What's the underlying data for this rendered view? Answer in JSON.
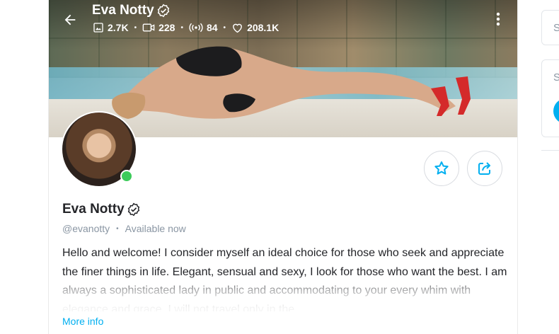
{
  "header": {
    "name": "Eva Notty",
    "stats": {
      "photos": "2.7K",
      "videos": "228",
      "streams": "84",
      "likes": "208.1K"
    }
  },
  "profile": {
    "name": "Eva Notty",
    "handle": "@evanotty",
    "status": "Available now",
    "bio": "Hello and welcome! I consider myself an ideal choice for those who seek and appreciate the finer things in life. Elegant, sensual and sexy, I look for those who want the best. I am always a sophisticated lady in public and accommodating to your every whim with elegance and grace. I will not travel only in the…",
    "more_info_label": "More info",
    "online": true
  },
  "sidebar": {
    "box1_letter": "S",
    "box2_letter": "S"
  },
  "colors": {
    "accent": "#00aff0",
    "online": "#3ccb5a",
    "muted": "#8a96a3",
    "text": "#242529"
  },
  "icons": [
    "back-arrow-icon",
    "verified-icon",
    "image-icon",
    "video-icon",
    "live-stream-icon",
    "heart-icon",
    "more-vertical-icon",
    "star-icon",
    "share-icon"
  ]
}
